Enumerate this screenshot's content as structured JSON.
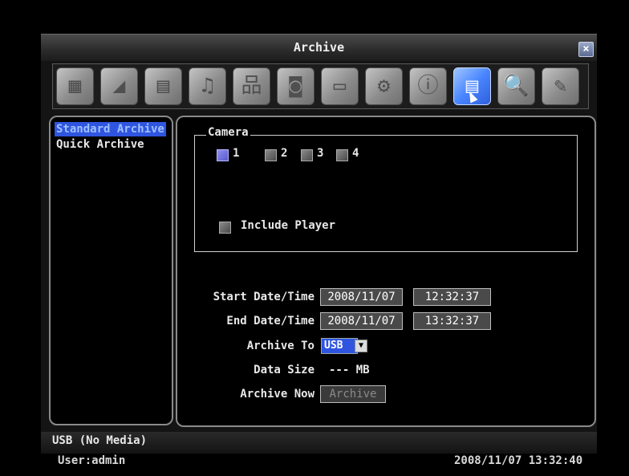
{
  "window": {
    "title": "Archive",
    "close_label": "×"
  },
  "toolbar": {
    "tools": [
      {
        "icon": "film-icon",
        "glyph": "▦"
      },
      {
        "icon": "camera-icon",
        "glyph": "◢"
      },
      {
        "icon": "schedule-icon",
        "glyph": "▤"
      },
      {
        "icon": "alarm-bell-icon",
        "glyph": "♫"
      },
      {
        "icon": "network-icon",
        "glyph": "品"
      },
      {
        "icon": "disk-icon",
        "glyph": "◙"
      },
      {
        "icon": "display-icon",
        "glyph": "▭"
      },
      {
        "icon": "gear-icon",
        "glyph": "⚙"
      },
      {
        "icon": "info-icon",
        "glyph": "ⓘ"
      },
      {
        "icon": "archive-icon",
        "glyph": "▤",
        "active": true
      },
      {
        "icon": "search-icon",
        "glyph": "🔍"
      },
      {
        "icon": "tools-icon",
        "glyph": "✎"
      }
    ]
  },
  "menu": {
    "items": [
      "Standard Archive",
      "Quick Archive"
    ],
    "selected": "Standard Archive"
  },
  "camera_group": {
    "legend": "Camera",
    "cameras": [
      {
        "label": "1",
        "checked": true
      },
      {
        "label": "2",
        "checked": false
      },
      {
        "label": "3",
        "checked": false
      },
      {
        "label": "4",
        "checked": false
      }
    ],
    "include_player": {
      "label": "Include Player",
      "checked": false
    }
  },
  "form": {
    "start_label": "Start Date/Time",
    "start_date": "2008/11/07",
    "start_time": "12:32:37",
    "end_label": "End Date/Time",
    "end_date": "2008/11/07",
    "end_time": "13:32:37",
    "archive_to_label": "Archive To",
    "archive_to_value": "USB",
    "data_size_label": "Data Size",
    "data_size_value": "--- MB",
    "archive_now_label": "Archive Now",
    "archive_button": "Archive"
  },
  "status": {
    "text": "USB (No Media)"
  },
  "footer": {
    "user": "User:admin",
    "datetime": "2008/11/07  13:32:40"
  },
  "colors": {
    "selection": "#2f55e0",
    "active_tool": "#4a86ff"
  }
}
